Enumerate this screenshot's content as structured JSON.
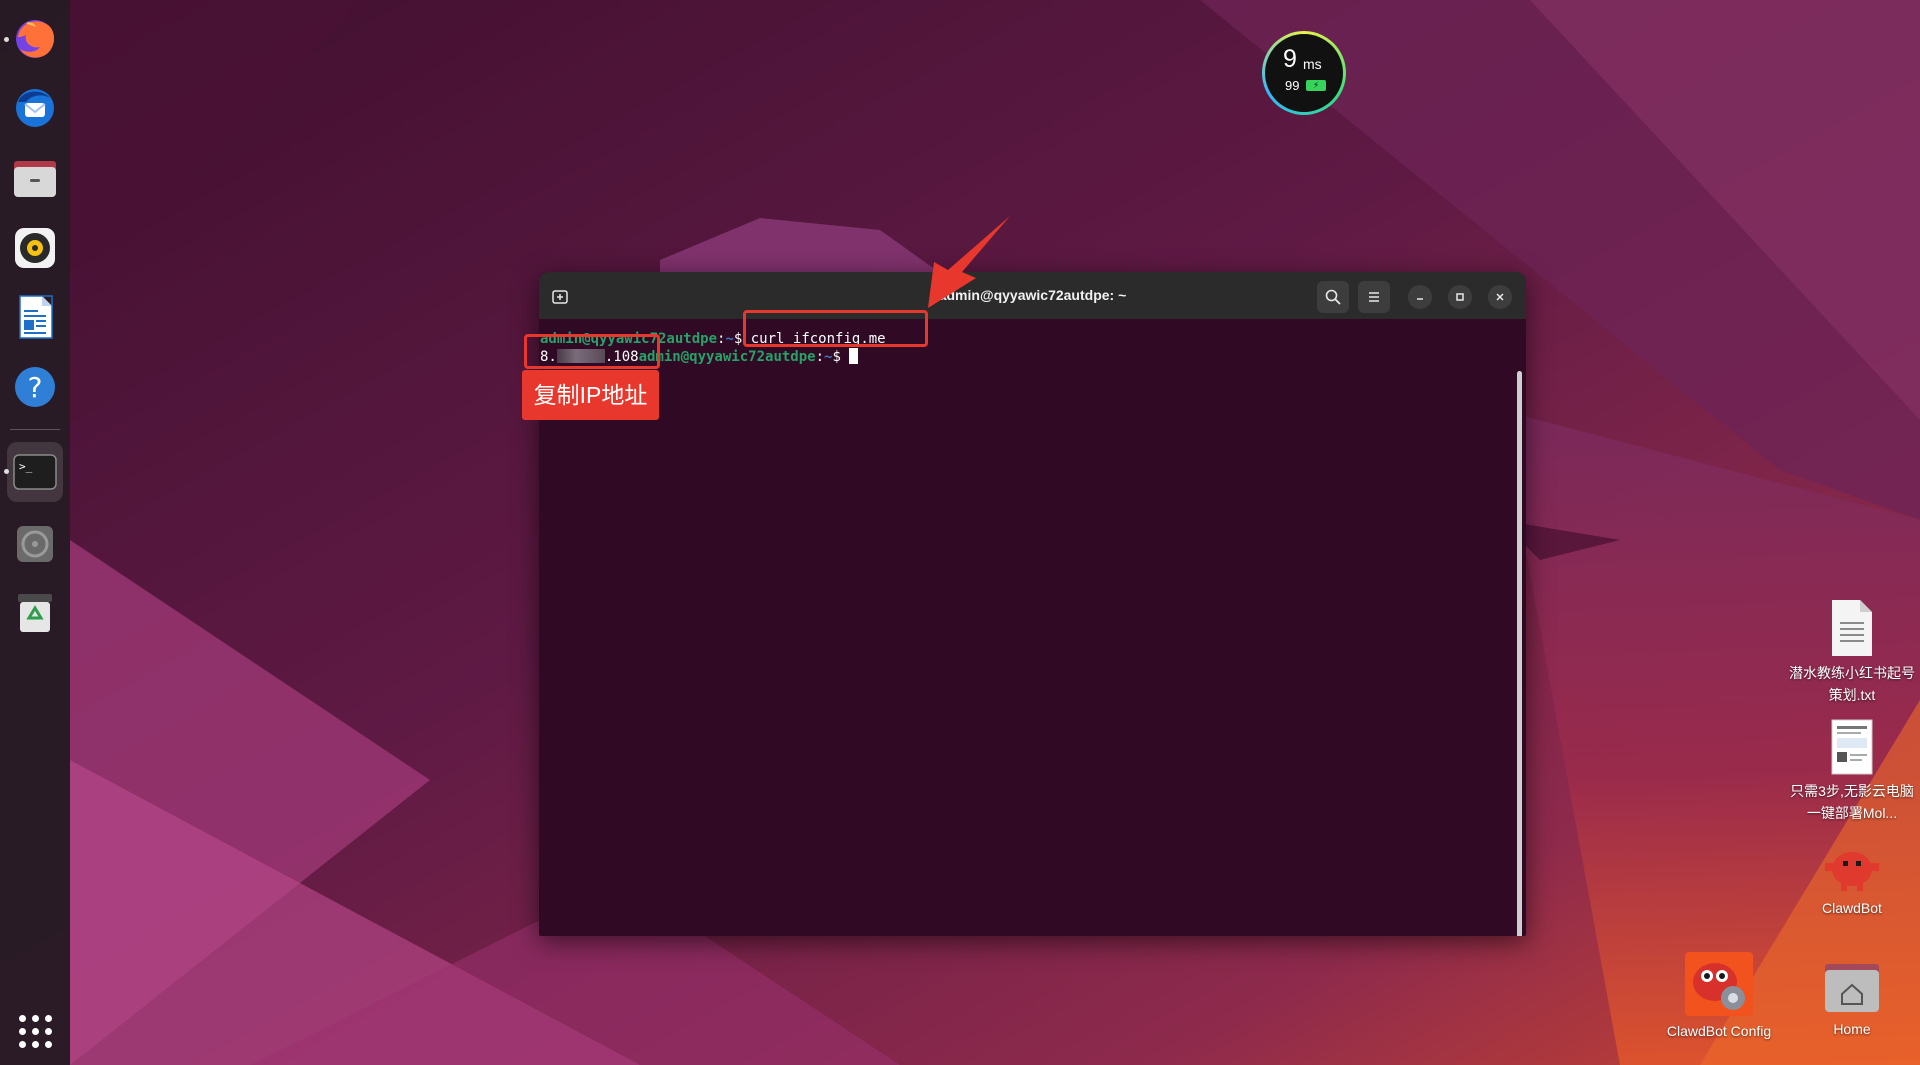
{
  "dock": {
    "items": [
      {
        "id": "firefox",
        "icon": "firefox-icon",
        "running": true
      },
      {
        "id": "thunderbird",
        "icon": "thunderbird-icon",
        "running": false
      },
      {
        "id": "files",
        "icon": "files-icon",
        "running": false
      },
      {
        "id": "rhythmbox",
        "icon": "rhythmbox-icon",
        "running": false
      },
      {
        "id": "writer",
        "icon": "libreoffice-writer-icon",
        "running": false
      },
      {
        "id": "help",
        "icon": "help-icon",
        "running": false
      },
      {
        "id": "terminal",
        "icon": "terminal-icon",
        "running": true,
        "active": true
      },
      {
        "id": "optical-drive",
        "icon": "disc-icon",
        "running": false
      },
      {
        "id": "trash",
        "icon": "trash-icon",
        "running": false
      }
    ],
    "help_glyph": "?",
    "terminal_glyph": ">_",
    "app_grid_icon": "app-grid-icon"
  },
  "speed_widget": {
    "value": "9",
    "unit": "ms",
    "battery": "99"
  },
  "terminal": {
    "title": "admin@qyyawic72autdpe: ~",
    "lines": {
      "line1": {
        "user": "admin@qyyawic72autdpe",
        "sep": ":",
        "path": "~",
        "cmd": "$ curl ifconfig.me"
      },
      "line2": {
        "ip_start": "8.",
        "ip_end": ".108",
        "user": "admin@qyyawic72autdpe",
        "sep": ":",
        "path": "~",
        "prompt": "$ "
      }
    }
  },
  "annotation": {
    "label": "复制IP地址",
    "color": "#e8382e"
  },
  "desktop_icons": [
    {
      "label": "潜水教练小红书起号策划.txt",
      "icon": "text-file-icon"
    },
    {
      "label": "只需3步,无影云电脑一键部署Mol...",
      "icon": "document-thumbnail-icon"
    },
    {
      "label": "ClawdBot",
      "icon": "clawdbot-icon"
    },
    {
      "label": "ClawdBot Config",
      "icon": "clawdbot-config-icon"
    },
    {
      "label": "Home",
      "icon": "home-folder-icon"
    }
  ],
  "colors": {
    "terminal_bg": "#300a24",
    "titlebar_bg": "#2b2b2b",
    "prompt_user": "#26a269",
    "prompt_path": "#3a75c4",
    "accent": "#e8382e"
  }
}
